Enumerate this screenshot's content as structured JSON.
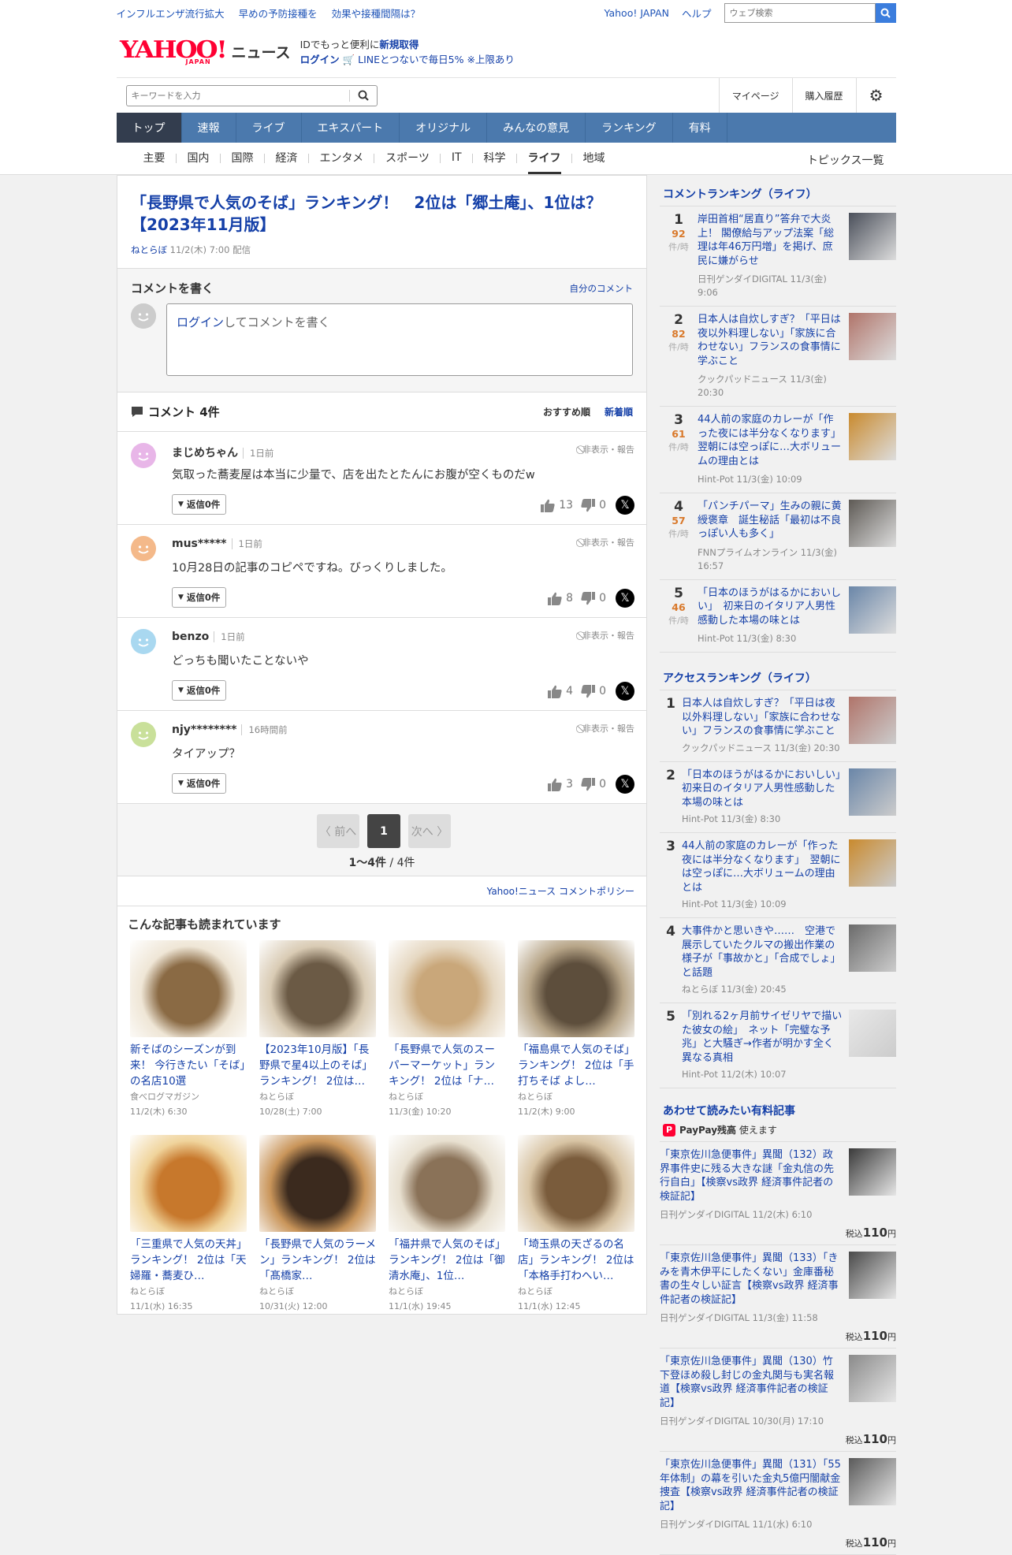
{
  "topbar": {
    "promo": [
      "インフルエンザ流行拡大",
      "早めの予防接種を",
      "効果や接種間隔は？"
    ],
    "yahoo": "Yahoo! JAPAN",
    "help": "ヘルプ",
    "search_placeholder": "ウェブ検索"
  },
  "logo": {
    "yahoo": "YAHOO!",
    "japan": "JAPAN",
    "news": "ニュース"
  },
  "login": {
    "line1_pre": "IDでもっと便利に",
    "line1_link": "新規取得",
    "login": "ログイン",
    "line2": "LINEとつないで毎日5% ※上限あり"
  },
  "search": {
    "placeholder": "キーワードを入力",
    "mypage": "マイページ",
    "history": "購入履歴"
  },
  "gnav": [
    "トップ",
    "速報",
    "ライブ",
    "エキスパート",
    "オリジナル",
    "みんなの意見",
    "ランキング",
    "有料"
  ],
  "snav": [
    "主要",
    "国内",
    "国際",
    "経済",
    "エンタメ",
    "スポーツ",
    "IT",
    "科学",
    "ライフ",
    "地域"
  ],
  "topics": "トピックス一覧",
  "article": {
    "title": "「長野県で人気のそば」ランキング！　2位は「郷土庵」、1位は？【2023年11月版】",
    "source": "ねとらぼ",
    "date": "11/2(木) 7:00 配信"
  },
  "comment_write": {
    "title": "コメントを書く",
    "mine": "自分のコメント",
    "login_link": "ログイン",
    "login_text": "してコメントを書く"
  },
  "comments": {
    "header": "コメント 4件",
    "sort_recommended": "おすすめ順",
    "sort_new": "新着順",
    "report": "非表示・報告",
    "reply": "返信0件",
    "items": [
      {
        "user": "まじめちゃん",
        "time": "1日前",
        "text": "気取った蕎麦屋は本当に少量で、店を出たとたんにお腹が空くものだw",
        "up": "13",
        "down": "0",
        "color": "#e8b6e8"
      },
      {
        "user": "mus*****",
        "time": "1日前",
        "text": "10月28日の記事のコピペですね。びっくりしました。",
        "up": "8",
        "down": "0",
        "color": "#f4b98a"
      },
      {
        "user": "benzo",
        "time": "1日前",
        "text": "どっちも聞いたことないや",
        "up": "4",
        "down": "0",
        "color": "#a9d8f0"
      },
      {
        "user": "njy********",
        "time": "16時間前",
        "text": "タイアップ？",
        "up": "3",
        "down": "0",
        "color": "#c9e09a"
      }
    ]
  },
  "pager": {
    "prev": "〈 前へ",
    "current": "1",
    "next": "次へ 〉",
    "range": "1〜4件",
    "total": "/ 4件"
  },
  "policy": "Yahoo!ニュース コメントポリシー",
  "related": {
    "title": "こんな記事も読まれています",
    "items": [
      {
        "title": "新そばのシーズンが到来！ 今行きたい「そば」の名店10選",
        "source": "食べログマガジン",
        "date": "11/2(木) 6:30",
        "c1": "#8a6a44",
        "c2": "#efe6d6"
      },
      {
        "title": "【2023年10月版】「長野県で星4以上のそば」ランキング！ 2位は…",
        "source": "ねとらぼ",
        "date": "10/28(土) 7:00",
        "c1": "#6b5a45",
        "c2": "#d9cbb4"
      },
      {
        "title": "「長野県で人気のスーパーマーケット」ランキング！ 2位は「ナ…",
        "source": "ねとらぼ",
        "date": "11/3(金) 10:20",
        "c1": "#c9a77a",
        "c2": "#e6d8c2"
      },
      {
        "title": "「福島県で人気のそば」ランキング！ 2位は「手打ちそば よし…",
        "source": "ねとらぼ",
        "date": "11/2(木) 9:00",
        "c1": "#5d4e3c",
        "c2": "#b7a588"
      },
      {
        "title": "「三重県で人気の天丼」ランキング！ 2位は「天婦羅・蕎麦ひ…",
        "source": "ねとらぼ",
        "date": "11/1(水) 16:35",
        "c1": "#c7782c",
        "c2": "#f0d49c"
      },
      {
        "title": "「長野県で人気のラーメン」ランキング！ 2位は「髙橋家…",
        "source": "ねとらぼ",
        "date": "10/31(火) 12:00",
        "c1": "#3b2a1e",
        "c2": "#c9955a"
      },
      {
        "title": "「福井県で人気のそば」ランキング！ 2位は「御清水庵」、1位…",
        "source": "ねとらぼ",
        "date": "11/1(水) 19:45",
        "c1": "#8a7258",
        "c2": "#e8e0d0"
      },
      {
        "title": "「埼玉県の天ざるの名店」ランキング！ 2位は「本格手打わへい…",
        "source": "ねとらぼ",
        "date": "11/1(水) 12:45",
        "c1": "#7a5c3c",
        "c2": "#d8c4a4"
      }
    ]
  },
  "comment_ranking": {
    "title": "コメントランキング（ライフ）",
    "unit": "件/時",
    "items": [
      {
        "rank": "1",
        "count": "92",
        "title": "岸田首相“居直り”答弁で大炎上！ 閣僚給与アップ法案「総理は年46万円増」を掲げ、庶民に嫌がらせ",
        "meta": "日刊ゲンダイDIGITAL 11/3(金) 9:06",
        "c": "#4a4f5a"
      },
      {
        "rank": "2",
        "count": "82",
        "title": "日本人は自炊しすぎ？「平日は夜以外料理しない」「家族に合わせない」フランスの食事情に学ぶこと",
        "meta": "クックパッドニュース 11/3(金) 20:30",
        "c": "#b0746a"
      },
      {
        "rank": "3",
        "count": "61",
        "title": "44人前の家庭のカレーが「作った夜には半分なくなります」翌朝には空っぽに…大ボリュームの理由とは",
        "meta": "Hint-Pot 11/3(金) 10:09",
        "c": "#c98a2e"
      },
      {
        "rank": "4",
        "count": "57",
        "title": "「パンチパーマ」生みの親に黄綬褒章　誕生秘話「最初は不良っぽい人も多く」",
        "meta": "FNNプライムオンライン 11/3(金) 16:57",
        "c": "#5e5a55"
      },
      {
        "rank": "5",
        "count": "46",
        "title": "「日本のほうがはるかにおいしい」　初来日のイタリア人男性感動した本場の味とは",
        "meta": "Hint-Pot 11/3(金) 8:30",
        "c": "#6a86a8"
      }
    ]
  },
  "access_ranking": {
    "title": "アクセスランキング（ライフ）",
    "items": [
      {
        "rank": "1",
        "title": "日本人は自炊しすぎ？「平日は夜以外料理しない」「家族に合わせない」フランスの食事情に学ぶこと",
        "meta": "クックパッドニュース 11/3(金) 20:30",
        "c": "#b0746a"
      },
      {
        "rank": "2",
        "title": "「日本のほうがはるかにおいしい」　初来日のイタリア人男性感動した本場の味とは",
        "meta": "Hint-Pot 11/3(金) 8:30",
        "c": "#6a86a8"
      },
      {
        "rank": "3",
        "title": "44人前の家庭のカレーが「作った夜には半分なくなります」　翌朝には空っぽに…大ボリュームの理由とは",
        "meta": "Hint-Pot 11/3(金) 10:09",
        "c": "#c98a2e"
      },
      {
        "rank": "4",
        "title": "大事件かと思いきや……　空港で展示していたクルマの搬出作業の様子が「事故かと」「合成でしょ」と話題",
        "meta": "ねとらぼ 11/3(金) 20:45",
        "c": "#6b6b6b"
      },
      {
        "rank": "5",
        "title": "「別れる2ヶ月前サイゼリヤで描いた彼女の絵」　ネット「完璧な予兆」と大騒ぎ→作者が明かす全く異なる真相",
        "meta": "Hint-Pot 11/2(木) 10:07",
        "c": "#e8e8e8"
      }
    ]
  },
  "paid": {
    "title": "あわせて読みたい有料記事",
    "paypay": "PayPay残高",
    "paypay_suffix": "使えます",
    "price_label": "税込",
    "price": "110",
    "yen": "円",
    "items": [
      {
        "title": "「東京佐川急便事件」異聞（132）政界事件史に残る大きな謎「金丸信の先行自白」【検察vs政界 経済事件記者の検証記】",
        "meta": "日刊ゲンダイDIGITAL 11/2(木) 6:10",
        "c": "#3a3a3a"
      },
      {
        "title": "「東京佐川急便事件」異聞（133）「きみを青木伊平にしたくない」金庫番秘書の生々しい証言【検察vs政界 経済事件記者の検証記】",
        "meta": "日刊ゲンダイDIGITAL 11/3(金) 11:58",
        "c": "#4a4a4a"
      },
      {
        "title": "「東京佐川急便事件」異聞（130）竹下登ほめ殺し封じの金丸関与も実名報道【検察vs政界 経済事件記者の検証記】",
        "meta": "日刊ゲンダイDIGITAL 10/30(月) 17:10",
        "c": "#8a8a8a"
      },
      {
        "title": "「東京佐川急便事件」異聞（131）「55年体制」の幕を引いた金丸5億円闇献金捜査【検察vs政界 経済事件記者の検証記】",
        "meta": "日刊ゲンダイDIGITAL 11/1(水) 6:10",
        "c": "#5a5a5a"
      }
    ]
  }
}
